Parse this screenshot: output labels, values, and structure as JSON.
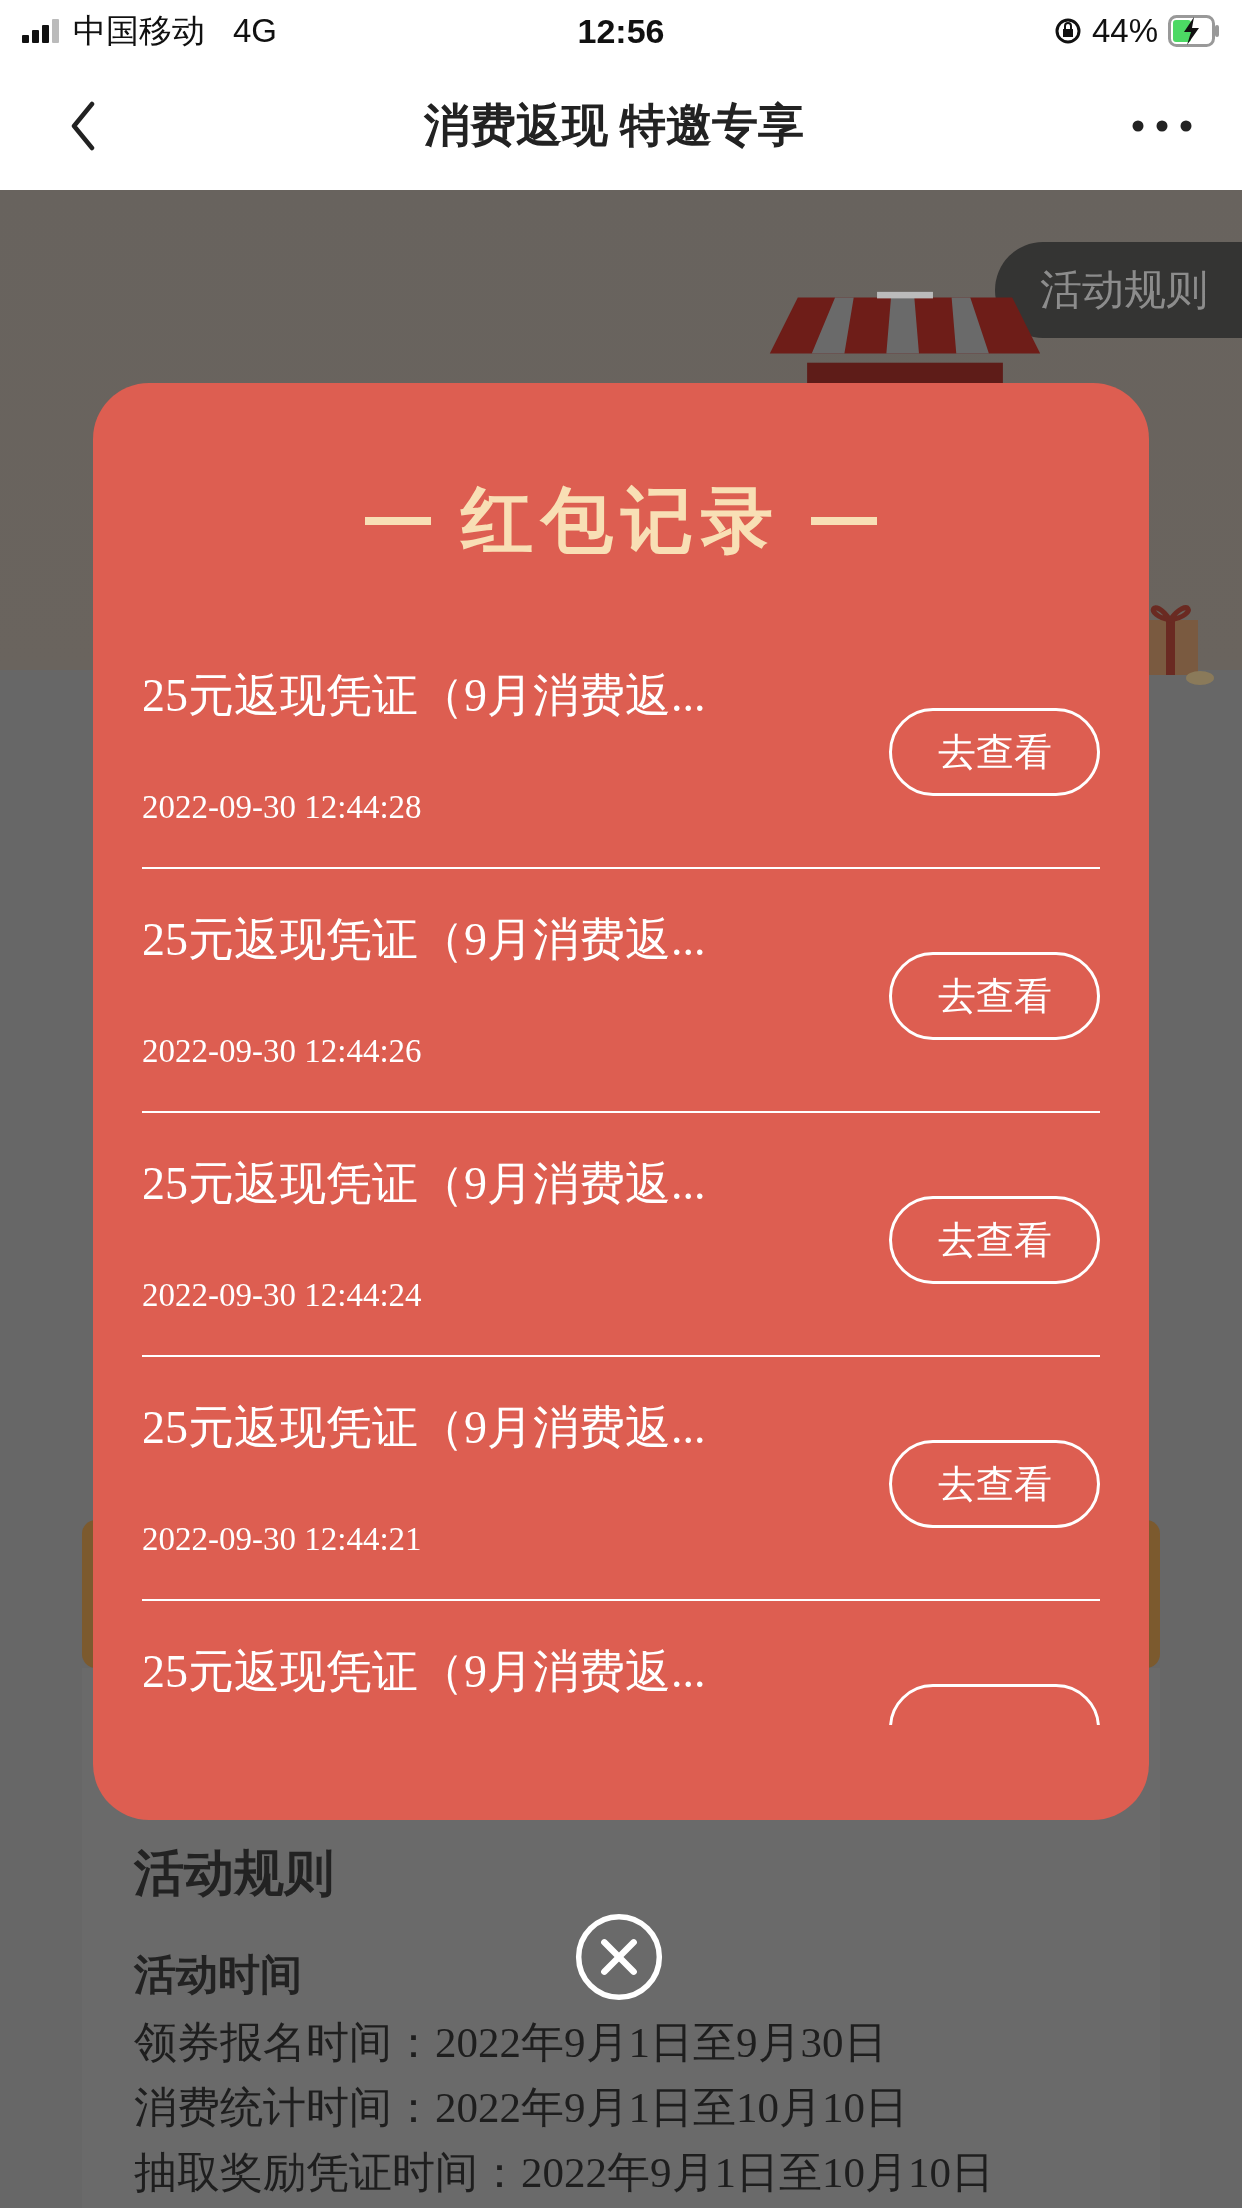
{
  "status_bar": {
    "carrier": "中国移动",
    "network": "4G",
    "time": "12:56",
    "battery": "44%",
    "charging": true
  },
  "nav": {
    "title": "消费返现 特邀专享"
  },
  "page": {
    "rules_tab": "活动规则",
    "rules": {
      "heading": "活动规则",
      "subheading": "活动时间",
      "lines": [
        "领券报名时间：2022年9月1日至9月30日",
        "消费统计时间：2022年9月1日至10月10日",
        "抽取奖励凭证时间：2022年9月1日至10月10日"
      ]
    }
  },
  "modal": {
    "title": "红包记录",
    "records": [
      {
        "title": "25元返现凭证（9月消费返...",
        "time": "2022-09-30 12:44:28",
        "button": "去查看"
      },
      {
        "title": "25元返现凭证（9月消费返...",
        "time": "2022-09-30 12:44:26",
        "button": "去查看"
      },
      {
        "title": "25元返现凭证（9月消费返...",
        "time": "2022-09-30 12:44:24",
        "button": "去查看"
      },
      {
        "title": "25元返现凭证（9月消费返...",
        "time": "2022-09-30 12:44:21",
        "button": "去查看"
      },
      {
        "title": "25元返现凭证（9月消费返..."
      }
    ]
  }
}
